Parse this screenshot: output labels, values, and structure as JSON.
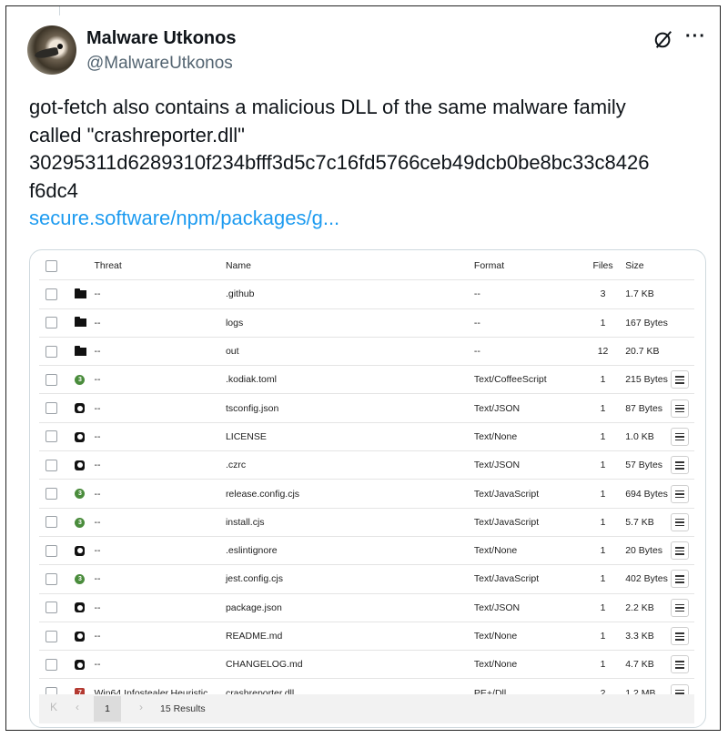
{
  "tweet": {
    "display_name": "Malware Utkonos",
    "handle": "@MalwareUtkonos",
    "text_lines": [
      "got-fetch also contains a malicious DLL of the same malware family",
      "called \"crashreporter.dll\"",
      "30295311d6289310f234bfff3d5c7c16fd5766ceb49dcb0be8bc33c8426",
      "f6dc4"
    ],
    "link_text": "secure.software/npm/packages/g..."
  },
  "table": {
    "headers": {
      "threat": "Threat",
      "name": "Name",
      "format": "Format",
      "files": "Files",
      "size": "Size"
    },
    "rows": [
      {
        "icon": "folder-icon",
        "threat": "--",
        "name": ".github",
        "format": "--",
        "files": "3",
        "size": "1.7 KB"
      },
      {
        "icon": "folder-icon",
        "threat": "--",
        "name": "logs",
        "format": "--",
        "files": "1",
        "size": "167 Bytes"
      },
      {
        "icon": "folder-icon",
        "threat": "--",
        "name": "out",
        "format": "--",
        "files": "12",
        "size": "20.7 KB"
      },
      {
        "icon": "green-badge-icon",
        "badge": "3",
        "threat": "--",
        "name": ".kodiak.toml",
        "format": "Text/CoffeeScript",
        "files": "1",
        "size": "215 Bytes",
        "menu": true
      },
      {
        "icon": "file-icon",
        "threat": "--",
        "name": "tsconfig.json",
        "format": "Text/JSON",
        "files": "1",
        "size": "87 Bytes",
        "menu": true
      },
      {
        "icon": "file-icon",
        "threat": "--",
        "name": "LICENSE",
        "format": "Text/None",
        "files": "1",
        "size": "1.0 KB",
        "menu": true
      },
      {
        "icon": "file-icon",
        "threat": "--",
        "name": ".czrc",
        "format": "Text/JSON",
        "files": "1",
        "size": "57 Bytes",
        "menu": true
      },
      {
        "icon": "green-badge-icon",
        "badge": "3",
        "threat": "--",
        "name": "release.config.cjs",
        "format": "Text/JavaScript",
        "files": "1",
        "size": "694 Bytes",
        "menu": true
      },
      {
        "icon": "green-badge-icon",
        "badge": "3",
        "threat": "--",
        "name": "install.cjs",
        "format": "Text/JavaScript",
        "files": "1",
        "size": "5.7 KB",
        "menu": true
      },
      {
        "icon": "file-icon",
        "threat": "--",
        "name": ".eslintignore",
        "format": "Text/None",
        "files": "1",
        "size": "20 Bytes",
        "menu": true
      },
      {
        "icon": "green-badge-icon",
        "badge": "3",
        "threat": "--",
        "name": "jest.config.cjs",
        "format": "Text/JavaScript",
        "files": "1",
        "size": "402 Bytes",
        "menu": true
      },
      {
        "icon": "file-icon",
        "threat": "--",
        "name": "package.json",
        "format": "Text/JSON",
        "files": "1",
        "size": "2.2 KB",
        "menu": true
      },
      {
        "icon": "file-icon",
        "threat": "--",
        "name": "README.md",
        "format": "Text/None",
        "files": "1",
        "size": "3.3 KB",
        "menu": true
      },
      {
        "icon": "file-icon",
        "threat": "--",
        "name": "CHANGELOG.md",
        "format": "Text/None",
        "files": "1",
        "size": "4.7 KB",
        "menu": true
      },
      {
        "icon": "red-badge-icon",
        "badge": "7",
        "threat": "Win64.Infostealer.Heuristic",
        "name": "crashreporter.dll",
        "format": "PE+/Dll",
        "files": "2",
        "size": "1.2 MB",
        "menu": true
      }
    ]
  },
  "pager": {
    "first": "K",
    "prev": "‹",
    "page": "1",
    "next": "›",
    "results": "15 Results"
  },
  "colors": {
    "link": "#1d9bf0",
    "safe_badge": "#4a8c3c",
    "threat_badge": "#b43a32"
  }
}
